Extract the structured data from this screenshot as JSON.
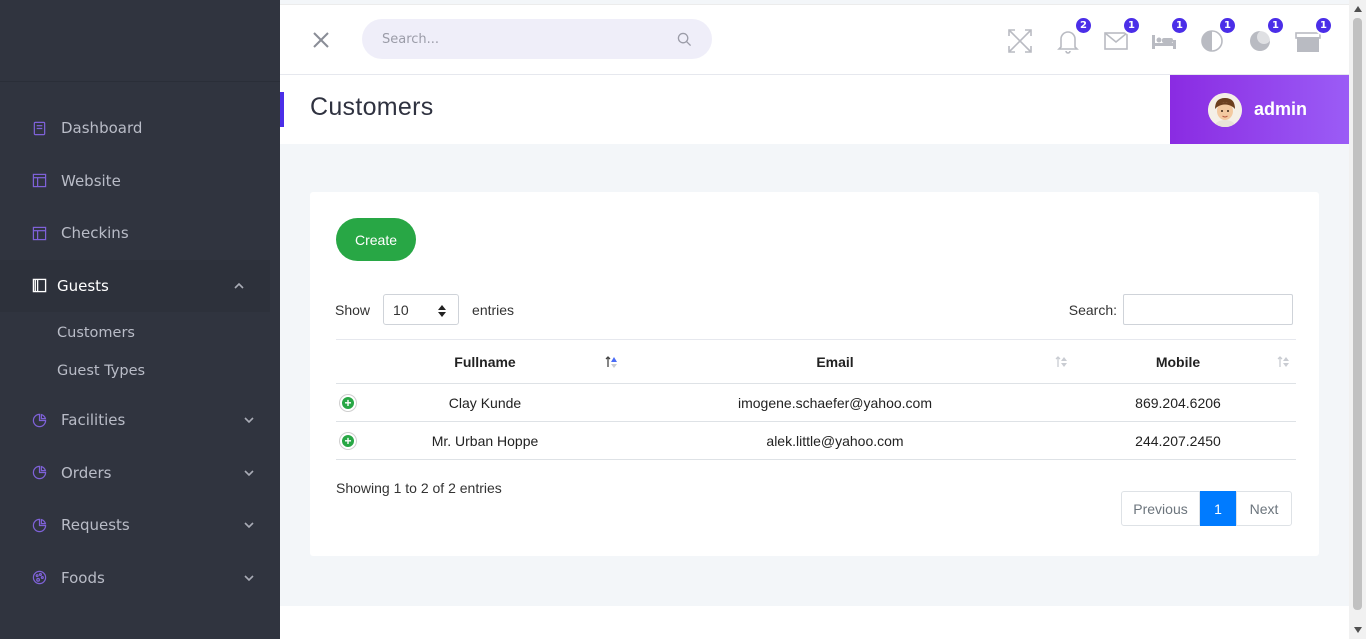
{
  "sidebar": {
    "items": [
      {
        "label": "Dashboard",
        "icon": "book-icon"
      },
      {
        "label": "Website",
        "icon": "layout-icon"
      },
      {
        "label": "Checkins",
        "icon": "layout-icon"
      },
      {
        "label": "Guests",
        "icon": "book-open-icon",
        "expanded": true,
        "children": [
          {
            "label": "Customers"
          },
          {
            "label": "Guest Types"
          }
        ]
      },
      {
        "label": "Facilities",
        "icon": "pie-chart-icon"
      },
      {
        "label": "Orders",
        "icon": "pie-chart-icon"
      },
      {
        "label": "Requests",
        "icon": "pie-chart-icon"
      },
      {
        "label": "Foods",
        "icon": "palette-icon"
      }
    ]
  },
  "topbar": {
    "search_placeholder": "Search...",
    "icons": [
      {
        "name": "fullscreen-icon",
        "badge": null
      },
      {
        "name": "bell-icon",
        "badge": "2"
      },
      {
        "name": "mail-icon",
        "badge": "1"
      },
      {
        "name": "bed-icon",
        "badge": "1"
      },
      {
        "name": "half-circle-icon",
        "badge": "1"
      },
      {
        "name": "moon-icon",
        "badge": "1"
      },
      {
        "name": "box-icon",
        "badge": "1"
      }
    ],
    "badge_color": "#4b2ee8"
  },
  "page": {
    "title": "Customers"
  },
  "user": {
    "name": "admin",
    "gradient": [
      "#8a2be2",
      "#9b5cf6"
    ]
  },
  "content": {
    "create_label": "Create",
    "show_label": "Show",
    "entries_label": "entries",
    "page_length": "10",
    "search_label": "Search:",
    "columns": [
      "Fullname",
      "Email",
      "Mobile"
    ],
    "rows": [
      {
        "fullname": "Clay Kunde",
        "email": "imogene.schaefer@yahoo.com",
        "mobile": "869.204.6206"
      },
      {
        "fullname": "Mr. Urban Hoppe",
        "email": "alek.little@yahoo.com",
        "mobile": "244.207.2450"
      }
    ],
    "info": "Showing 1 to 2 of 2 entries",
    "pagination": {
      "previous": "Previous",
      "current": "1",
      "next": "Next"
    },
    "accent_green": "#28a745",
    "accent_blue": "#007bff"
  }
}
